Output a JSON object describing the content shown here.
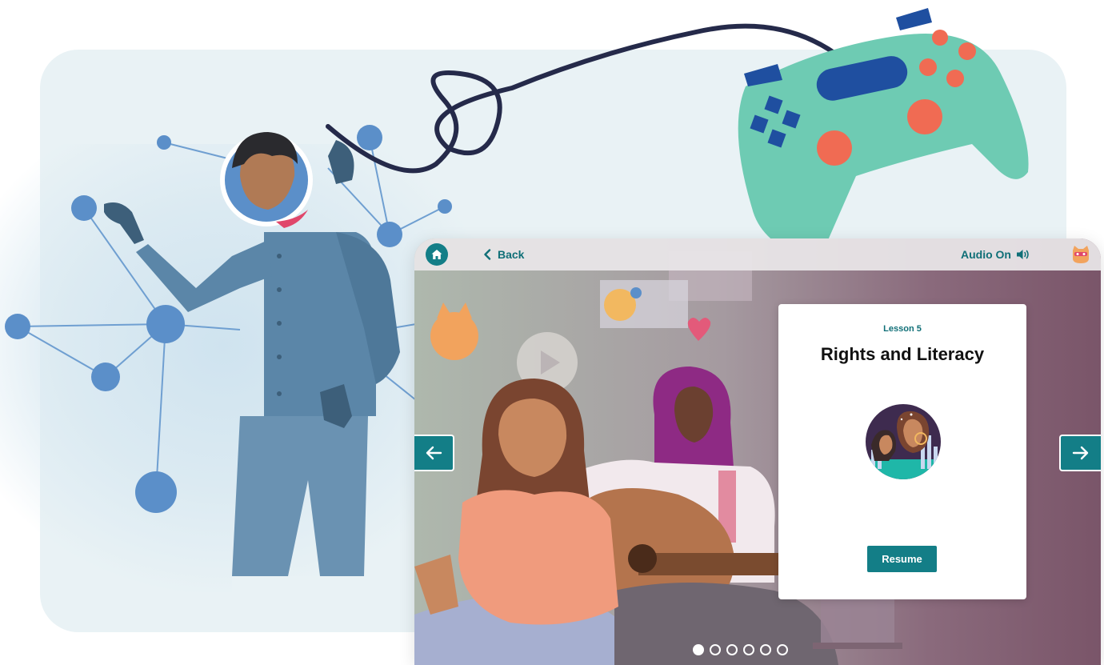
{
  "topbar": {
    "back_label": "Back",
    "audio_label": "Audio On"
  },
  "lesson": {
    "number_label": "Lesson 5",
    "title": "Rights and Literacy",
    "button_label": "Resume"
  },
  "pagination": {
    "total": 6,
    "active_index": 0
  },
  "icons": {
    "home": "home-icon",
    "back": "chevron-left-icon",
    "audio": "speaker-icon",
    "profile": "cat-avatar-icon",
    "prev": "arrow-left-icon",
    "next": "arrow-right-icon"
  },
  "colors": {
    "teal": "#137e87",
    "panel": "#e9f2f5",
    "controller": "#6ecbb3",
    "controller_accent": "#f06b53",
    "controller_buttons": "#1f4fa0",
    "figure": "#5b86a8",
    "network_node": "#5b8fc9"
  }
}
